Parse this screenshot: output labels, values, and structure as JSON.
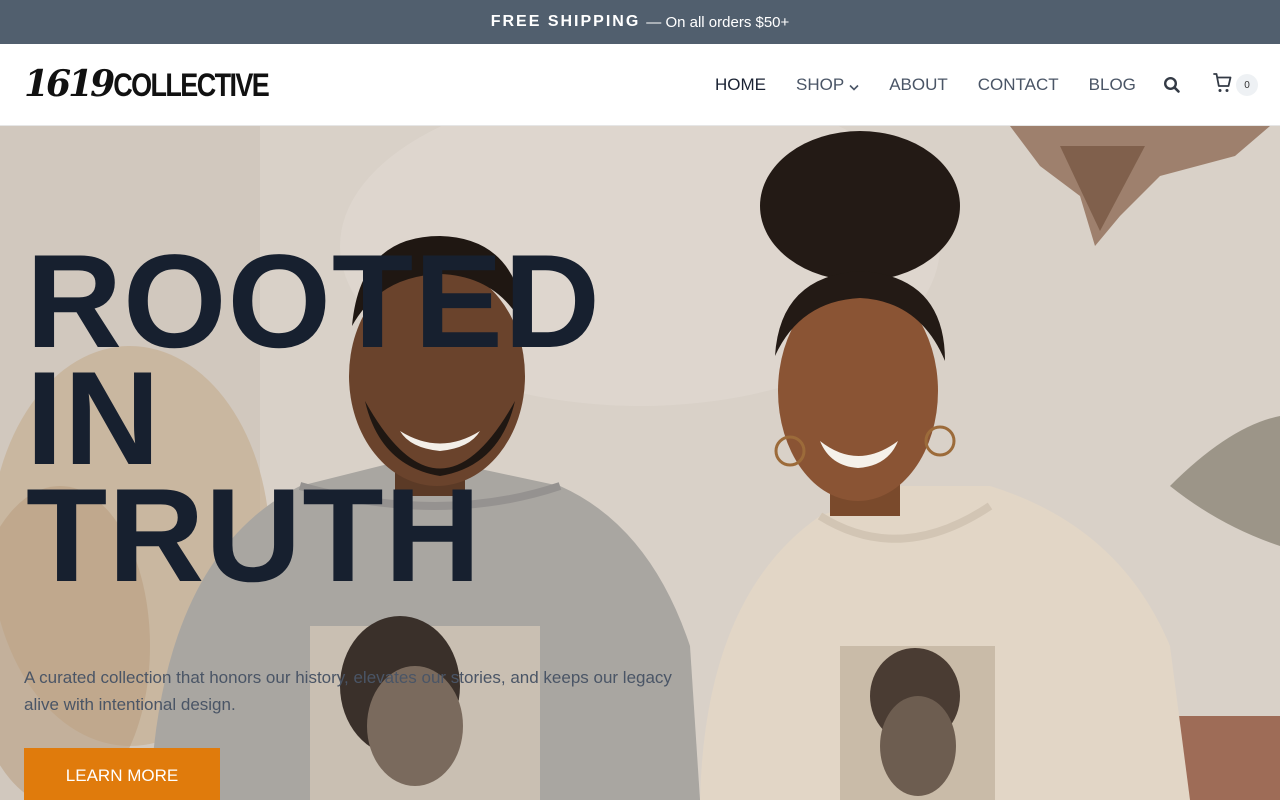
{
  "announcement": {
    "strong": "FREE SHIPPING",
    "rest": "— On all orders $50+"
  },
  "header": {
    "logo_number": "1619",
    "logo_word": "COLLECTIVE",
    "nav": [
      {
        "label": "HOME",
        "active": true
      },
      {
        "label": "SHOP",
        "has_dropdown": true
      },
      {
        "label": "ABOUT"
      },
      {
        "label": "CONTACT"
      },
      {
        "label": "BLOG"
      }
    ],
    "search_icon": "search-icon",
    "cart_icon": "cart-icon",
    "cart_count": "0"
  },
  "hero": {
    "title_lines": [
      "ROOTED",
      "IN",
      "TRUTH"
    ],
    "description": "A curated collection that honors our history, elevates our stories, and keeps our legacy alive with intentional design.",
    "button_label": "LEARN MORE",
    "image_subject": "Smiling man and woman wearing printed sweatshirts"
  },
  "colors": {
    "announcement_bg": "#515f6e",
    "button_bg": "#e07b0c",
    "title_text": "#17202f",
    "nav_text": "#4a5566"
  }
}
